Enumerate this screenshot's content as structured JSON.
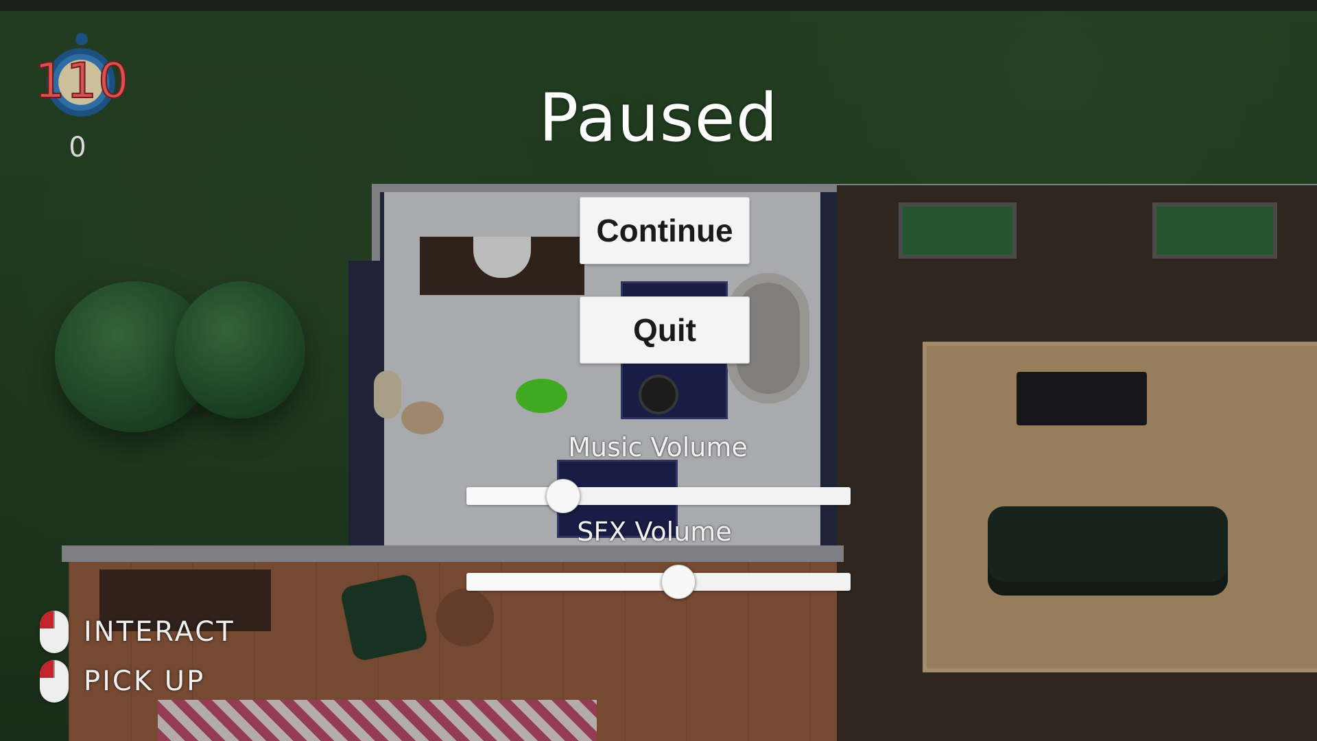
{
  "hud": {
    "timer_value": "110",
    "timer_icon": "stopwatch-icon",
    "score": "0"
  },
  "pause_menu": {
    "title": "Paused",
    "continue_label": "Continue",
    "quit_label": "Quit",
    "music_volume_label": "Music Volume",
    "sfx_volume_label": "SFX Volume",
    "music_volume": 0.25,
    "sfx_volume": 0.55
  },
  "controls": [
    {
      "icon": "mouse-left-click-icon",
      "label": "INTERACT"
    },
    {
      "icon": "mouse-left-click-icon",
      "label": "PICK UP"
    }
  ],
  "colors": {
    "timer_text": "#d8524f",
    "mouse_button": "#c4242c",
    "slime": "#4fcf2a"
  }
}
